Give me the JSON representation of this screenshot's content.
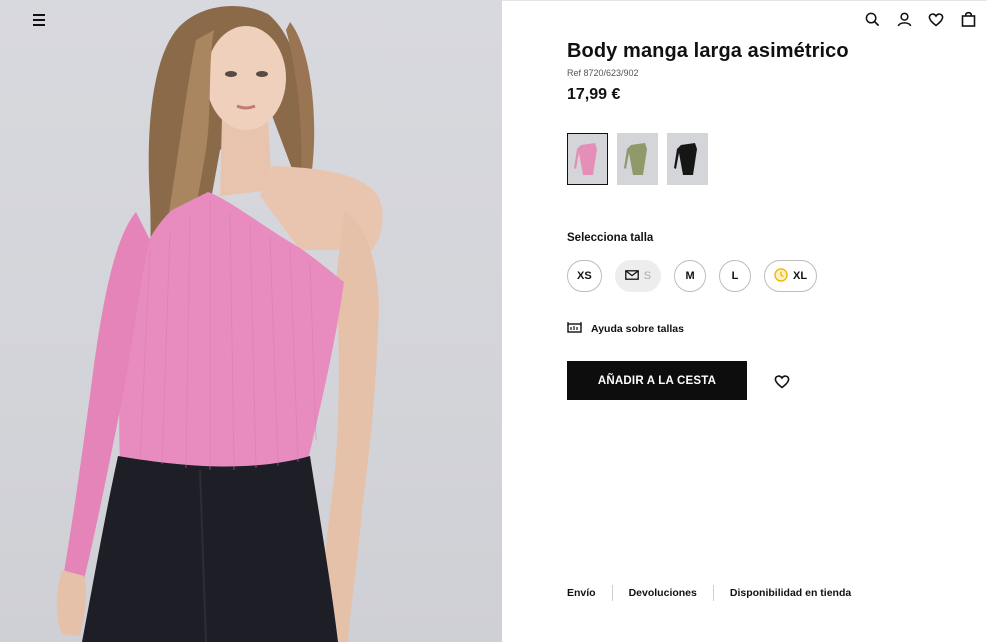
{
  "product": {
    "title": "Body manga larga asimétrico",
    "ref": "Ref 8720/623/902",
    "price": "17,99 €"
  },
  "colors": [
    {
      "name": "pink",
      "hex": "#e58fb8",
      "selected": true
    },
    {
      "name": "olive",
      "hex": "#8f9a6a",
      "selected": false
    },
    {
      "name": "black",
      "hex": "#161616",
      "selected": false
    }
  ],
  "sizes": {
    "label": "Selecciona talla",
    "options": [
      {
        "label": "XS",
        "state": "available"
      },
      {
        "label": "S",
        "state": "notify",
        "icon": "envelope-icon"
      },
      {
        "label": "M",
        "state": "available"
      },
      {
        "label": "L",
        "state": "available"
      },
      {
        "label": "XL",
        "state": "low-stock",
        "icon": "clock-icon"
      }
    ]
  },
  "help": {
    "label": "Ayuda sobre tallas",
    "icon": "ruler-icon"
  },
  "cart": {
    "add_label": "AÑADIR A LA CESTA"
  },
  "footer": {
    "shipping": "Envío",
    "returns": "Devoluciones",
    "store": "Disponibilidad en tienda"
  },
  "header": {
    "icons": [
      "search-icon",
      "user-icon",
      "heart-icon",
      "bag-icon"
    ]
  },
  "theme": {
    "accent": "#0d0d0d",
    "photo_bg": "#d6d7dc",
    "top_color": "#e88cbf"
  }
}
